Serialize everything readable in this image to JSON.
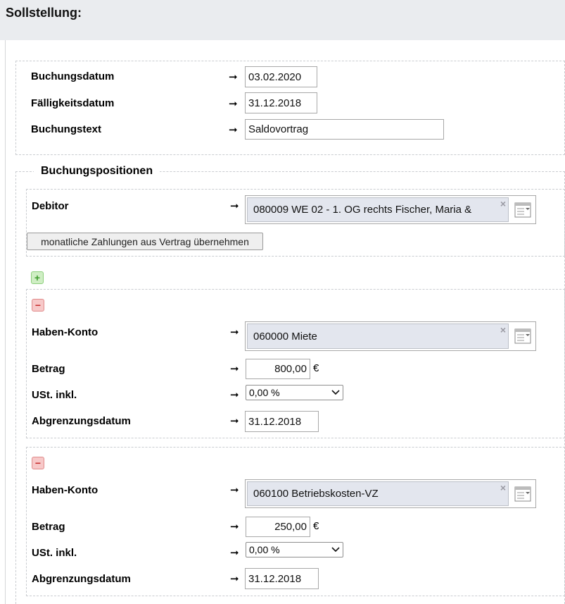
{
  "page": {
    "title": "Sollstellung:"
  },
  "header_fields": {
    "buchungsdatum": {
      "label": "Buchungsdatum",
      "value": "03.02.2020"
    },
    "faelligkeitsdatum": {
      "label": "Fälligkeitsdatum",
      "value": "31.12.2018"
    },
    "buchungstext": {
      "label": "Buchungstext",
      "value": "Saldovortrag"
    }
  },
  "positions": {
    "legend": "Buchungspositionen",
    "debitor": {
      "label": "Debitor",
      "value": "080009 WE 02 - 1. OG rechts Fischer, Maria &"
    },
    "copy_button": "monatliche Zahlungen aus Vertrag übernehmen",
    "add_icon": "plus-icon",
    "remove_icon": "minus-icon",
    "items": [
      {
        "konto_label": "Haben-Konto",
        "konto_value": "060000 Miete",
        "betrag_label": "Betrag",
        "betrag_value": "800,00",
        "currency": "€",
        "ust_label": "USt. inkl.",
        "ust_value": "0,00 %",
        "abgrenzung_label": "Abgrenzungsdatum",
        "abgrenzung_value": "31.12.2018"
      },
      {
        "konto_label": "Haben-Konto",
        "konto_value": "060100 Betriebskosten-VZ",
        "betrag_label": "Betrag",
        "betrag_value": "250,00",
        "currency": "€",
        "ust_label": "USt. inkl.",
        "ust_value": "0,00 %",
        "abgrenzung_label": "Abgrenzungsdatum",
        "abgrenzung_value": "31.12.2018"
      }
    ]
  },
  "symbols": {
    "arrow": "➞",
    "clear": "×",
    "caret": "⌄"
  },
  "colors": {
    "add": "#3b9a2a",
    "remove": "#c62d2d",
    "chosen_bg": "#e3e6ee"
  }
}
